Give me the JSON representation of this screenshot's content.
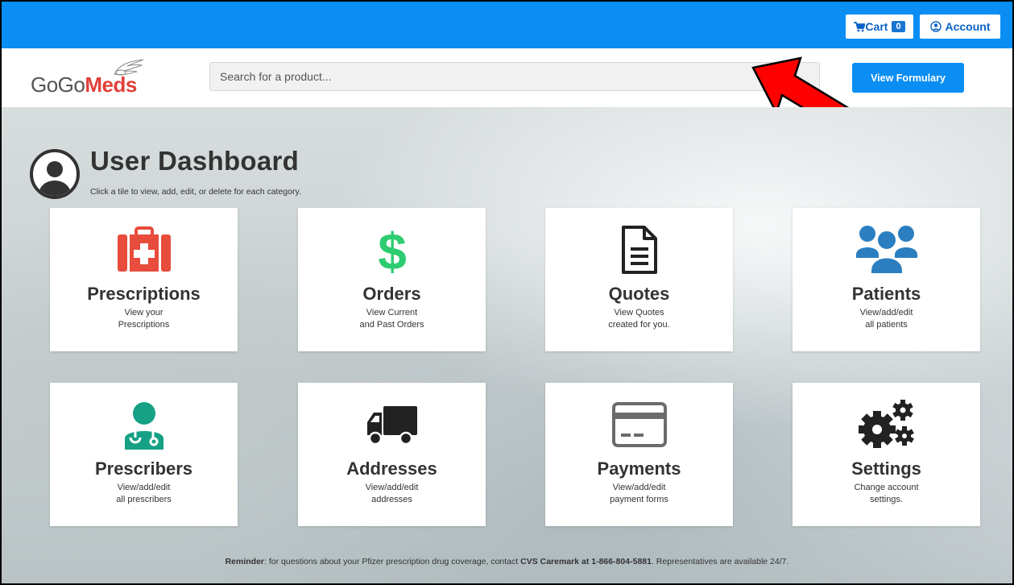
{
  "topbar": {
    "cart_label": "Cart",
    "cart_count": "0",
    "account_label": "Account",
    "bg_color": "#0a8ef3"
  },
  "header": {
    "logo_part1": "GoGo",
    "logo_part2": "Meds",
    "search_placeholder": "Search for a product...",
    "formulary_label": "View Formulary"
  },
  "dashboard": {
    "title": "User Dashboard",
    "subtitle": "Click a tile to view, add, edit, or delete for each category."
  },
  "tiles": [
    {
      "title": "Prescriptions",
      "line1": "View your",
      "line2": "Prescriptions",
      "icon": "first-aid-kit-icon",
      "color": "#e74c3c"
    },
    {
      "title": "Orders",
      "line1": "View Current",
      "line2": "and Past Orders",
      "icon": "dollar-icon",
      "color": "#2ecc71"
    },
    {
      "title": "Quotes",
      "line1": "View Quotes",
      "line2": "created for you.",
      "icon": "document-icon",
      "color": "#222222"
    },
    {
      "title": "Patients",
      "line1": "View/add/edit",
      "line2": "all patients",
      "icon": "users-icon",
      "color": "#2b7fc1"
    },
    {
      "title": "Prescribers",
      "line1": "View/add/edit",
      "line2": "all prescribers",
      "icon": "doctor-icon",
      "color": "#16a085"
    },
    {
      "title": "Addresses",
      "line1": "View/add/edit",
      "line2": "addresses",
      "icon": "truck-icon",
      "color": "#222222"
    },
    {
      "title": "Payments",
      "line1": "View/add/edit",
      "line2": "payment forms",
      "icon": "credit-card-icon",
      "color": "#6b6b6b"
    },
    {
      "title": "Settings",
      "line1": "Change account",
      "line2": "settings.",
      "icon": "gears-icon",
      "color": "#222222"
    }
  ],
  "reminder": {
    "label": "Reminder",
    "text1": ": for questions about your Pfizer prescription drug coverage, contact ",
    "contact": "CVS Caremark at 1-866-804-5881",
    "text2": ". Representatives are available 24/7."
  }
}
